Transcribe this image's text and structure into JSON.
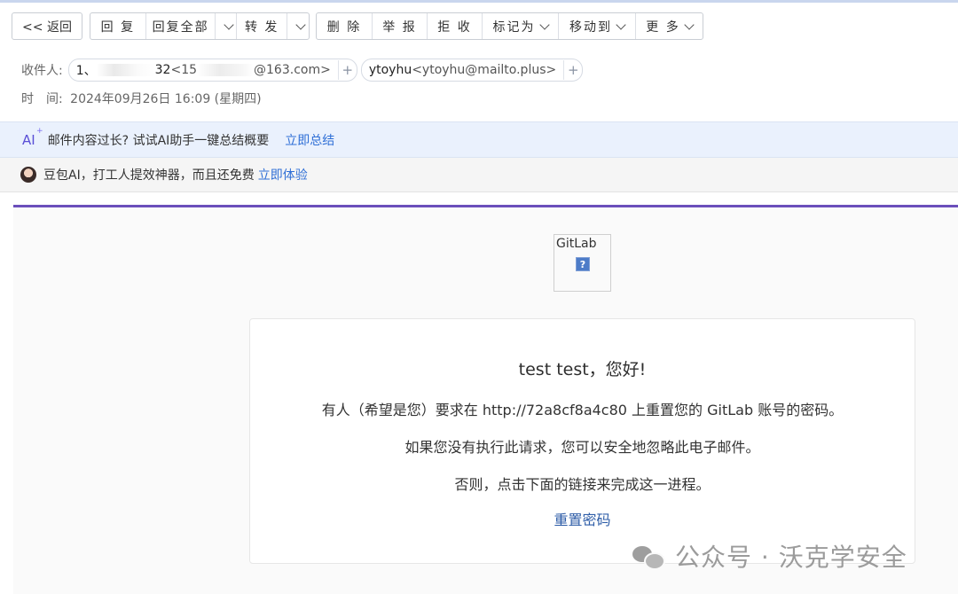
{
  "toolbar": {
    "back": "<< 返回",
    "reply": "回 复",
    "reply_all": "回复全部",
    "forward": "转 发",
    "delete": "删 除",
    "report": "举 报",
    "reject": "拒 收",
    "mark_as": "标记为",
    "move_to": "移动到",
    "more": "更 多"
  },
  "header": {
    "recipients_label": "收件人:",
    "recipient1": {
      "name_start": "1、",
      "name_mid": "32",
      "addr_start": "<15",
      "addr_end": "@163.com>"
    },
    "recipient2": {
      "name": "ytoyhu",
      "addr": "<ytoyhu@mailto.plus>"
    },
    "plus": "+",
    "time_label": "时　间:",
    "time_value": "2024年09月26日 16:09 (星期四)"
  },
  "ai_bar": {
    "icon_text": "AI",
    "icon_sup": "+",
    "text": "邮件内容过长? 试试AI助手一键总结概要",
    "link": "立即总结"
  },
  "doubao_bar": {
    "text": "豆包AI，打工人提效神器，而且还免费",
    "link": "立即体验"
  },
  "email": {
    "logo_alt": "GitLab",
    "logo_placeholder": "?",
    "greeting": "test test，您好!",
    "line1": "有人（希望是您）要求在 http://72a8cf8a4c80 上重置您的 GitLab 账号的密码。",
    "line2": "如果您没有执行此请求，您可以安全地忽略此电子邮件。",
    "line3": "否则，点击下面的链接来完成这一进程。",
    "reset_link": "重置密码"
  },
  "watermark": {
    "text": "公众号 · 沃克学安全"
  }
}
